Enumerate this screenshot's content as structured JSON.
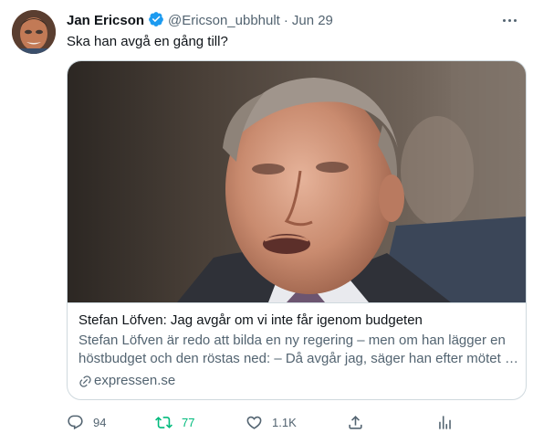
{
  "tweet": {
    "author_name": "Jan Ericson",
    "handle": "@Ericson_ubbhult",
    "separator": "·",
    "date": "Jun 29",
    "text": "Ska han avgå en gång till?"
  },
  "card": {
    "title": "Stefan Löfven: Jag avgår om vi inte får igenom budgeten",
    "description": "Stefan Löfven är redo att bilda en ny regering – men om han lägger en höstbudget och den röstas ned: – Då avgår jag, säger han efter mötet …",
    "domain": "expressen.se"
  },
  "actions": {
    "replies": "94",
    "retweets": "77",
    "likes": "1.1K"
  },
  "colors": {
    "text_primary": "#0f1419",
    "text_secondary": "#536471",
    "verified_blue": "#1d9bf0",
    "retweet_green": "#00ba7c",
    "border": "#cfd9de"
  },
  "icons": [
    "verified-badge-icon",
    "more-icon",
    "link-icon",
    "reply-icon",
    "retweet-icon",
    "like-icon",
    "share-icon",
    "analytics-icon"
  ]
}
